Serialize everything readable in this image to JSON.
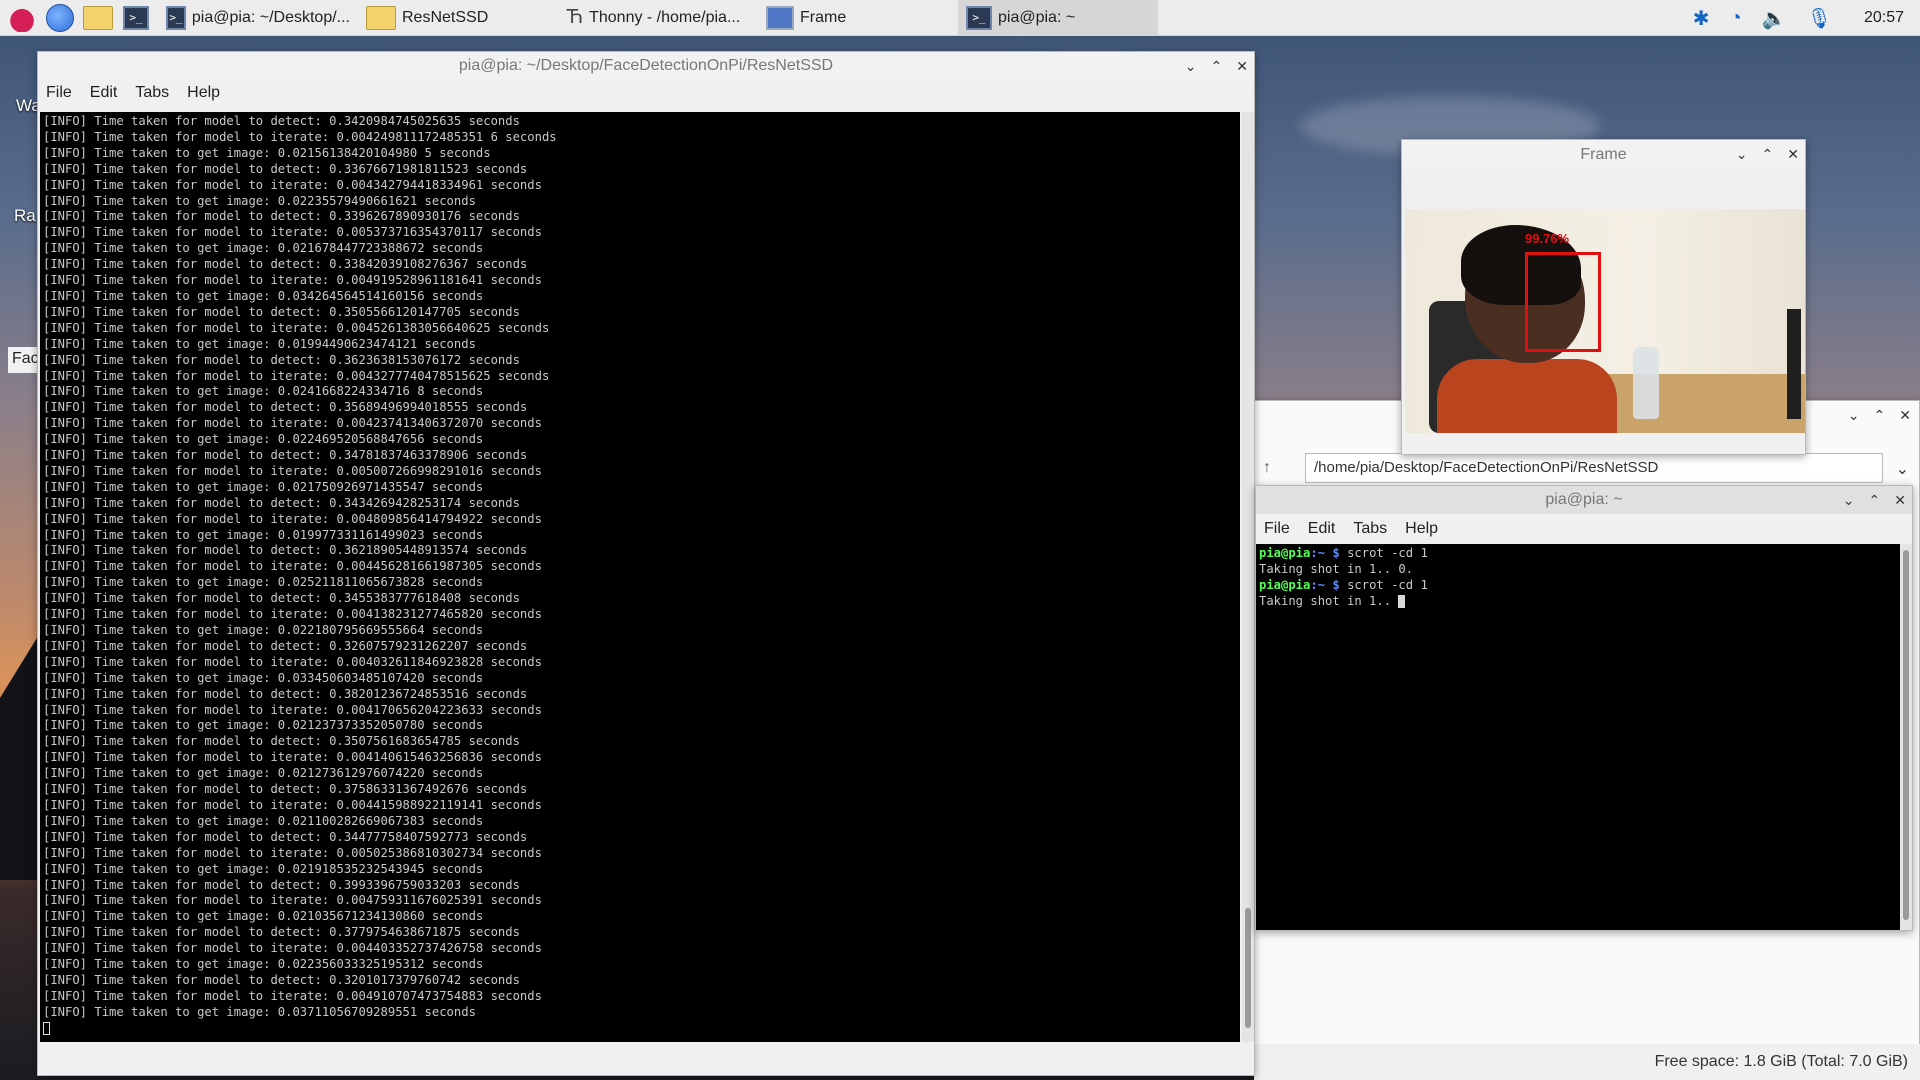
{
  "taskbar": {
    "tasks": [
      {
        "label": "pia@pia: ~/Desktop/...",
        "icon": "terminal-icon"
      },
      {
        "label": "ResNetSSD",
        "icon": "folder-icon"
      },
      {
        "label": "Thonny  -  /home/pia...",
        "icon": "thonny-icon"
      },
      {
        "label": "Frame",
        "icon": "frame-icon"
      },
      {
        "label": "pia@pia: ~",
        "icon": "terminal-icon"
      }
    ],
    "clock": "20:57"
  },
  "desktop": {
    "labels": [
      "Wa",
      "Ra",
      "Fac"
    ]
  },
  "main_terminal": {
    "title": "pia@pia: ~/Desktop/FaceDetectionOnPi/ResNetSSD",
    "menu": [
      "File",
      "Edit",
      "Tabs",
      "Help"
    ],
    "lines": [
      "[INFO] Time taken for model to detect: 0.3420984745025635 seconds",
      "[INFO] Time taken for model to iterate: 0.004249811172485351 6 seconds",
      "[INFO] Time taken to get image: 0.02156138420104980 5 seconds",
      "[INFO] Time taken for model to detect: 0.33676671981811523 seconds",
      "[INFO] Time taken for model to iterate: 0.004342794418334961 seconds",
      "[INFO] Time taken to get image: 0.02235579490661621 seconds",
      "[INFO] Time taken for model to detect: 0.3396267890930176 seconds",
      "[INFO] Time taken for model to iterate: 0.005373716354370117 seconds",
      "[INFO] Time taken to get image: 0.021678447723388672 seconds",
      "[INFO] Time taken for model to detect: 0.33842039108276367 seconds",
      "[INFO] Time taken for model to iterate: 0.004919528961181641 seconds",
      "[INFO] Time taken to get image: 0.034264564514160156 seconds",
      "[INFO] Time taken for model to detect: 0.3505566120147705 seconds",
      "[INFO] Time taken for model to iterate: 0.0045261383056640625 seconds",
      "[INFO] Time taken to get image: 0.01994490623474121 seconds",
      "[INFO] Time taken for model to detect: 0.3623638153076172 seconds",
      "[INFO] Time taken for model to iterate: 0.0043277740478515625 seconds",
      "[INFO] Time taken to get image: 0.0241668224334716 8 seconds",
      "[INFO] Time taken for model to detect: 0.35689496994018555 seconds",
      "[INFO] Time taken for model to iterate: 0.004237413406372070 seconds",
      "[INFO] Time taken to get image: 0.022469520568847656 seconds",
      "[INFO] Time taken for model to detect: 0.34781837463378906 seconds",
      "[INFO] Time taken for model to iterate: 0.005007266998291016 seconds",
      "[INFO] Time taken to get image: 0.021750926971435547 seconds",
      "[INFO] Time taken for model to detect: 0.3434269428253174 seconds",
      "[INFO] Time taken for model to iterate: 0.004809856414794922 seconds",
      "[INFO] Time taken to get image: 0.019977331161499023 seconds",
      "[INFO] Time taken for model to detect: 0.36218905448913574 seconds",
      "[INFO] Time taken for model to iterate: 0.004456281661987305 seconds",
      "[INFO] Time taken to get image: 0.025211811065673828 seconds",
      "[INFO] Time taken for model to detect: 0.3455383777618408 seconds",
      "[INFO] Time taken for model to iterate: 0.004138231277465820 seconds",
      "[INFO] Time taken to get image: 0.022180795669555664 seconds",
      "[INFO] Time taken for model to detect: 0.32607579231262207 seconds",
      "[INFO] Time taken for model to iterate: 0.004032611846923828 seconds",
      "[INFO] Time taken to get image: 0.033450603485107420 seconds",
      "[INFO] Time taken for model to detect: 0.38201236724853516 seconds",
      "[INFO] Time taken for model to iterate: 0.004170656204223633 seconds",
      "[INFO] Time taken to get image: 0.021237373352050780 seconds",
      "[INFO] Time taken for model to detect: 0.3507561683654785 seconds",
      "[INFO] Time taken for model to iterate: 0.004140615463256836 seconds",
      "[INFO] Time taken to get image: 0.021273612976074220 seconds",
      "[INFO] Time taken for model to detect: 0.37586331367492676 seconds",
      "[INFO] Time taken for model to iterate: 0.004415988922119141 seconds",
      "[INFO] Time taken to get image: 0.021100282669067383 seconds",
      "[INFO] Time taken for model to detect: 0.34477758407592773 seconds",
      "[INFO] Time taken for model to iterate: 0.005025386810302734 seconds",
      "[INFO] Time taken to get image: 0.021918535232543945 seconds",
      "[INFO] Time taken for model to detect: 0.3993396759033203 seconds",
      "[INFO] Time taken for model to iterate: 0.004759311676025391 seconds",
      "[INFO] Time taken to get image: 0.021035671234130860 seconds",
      "[INFO] Time taken for model to detect: 0.3779754638671875 seconds",
      "[INFO] Time taken for model to iterate: 0.004403352737426758 seconds",
      "[INFO] Time taken to get image: 0.022356033325195312 seconds",
      "[INFO] Time taken for model to detect: 0.3201017379760742 seconds",
      "[INFO] Time taken for model to iterate: 0.004910707473754883 seconds",
      "[INFO] Time taken to get image: 0.03711056709289551 seconds"
    ]
  },
  "frame_window": {
    "title": "Frame",
    "face_label": "99.76%"
  },
  "file_manager": {
    "path": "/home/pia/Desktop/FaceDetectionOnPi/ResNetSSD",
    "status": "Free space: 1.8 GiB (Total: 7.0 GiB)"
  },
  "small_terminal": {
    "title": "pia@pia: ~",
    "menu": [
      "File",
      "Edit",
      "Tabs",
      "Help"
    ],
    "lines": [
      {
        "prompt": "pia@pia",
        "path": ":~ $",
        "text": " scrot -cd 1"
      },
      {
        "prompt": "",
        "path": "",
        "text": "Taking shot in 1.. 0."
      },
      {
        "prompt": "pia@pia",
        "path": ":~ $",
        "text": " scrot -cd 1"
      },
      {
        "prompt": "",
        "path": "",
        "text": "Taking shot in 1.. "
      }
    ]
  }
}
